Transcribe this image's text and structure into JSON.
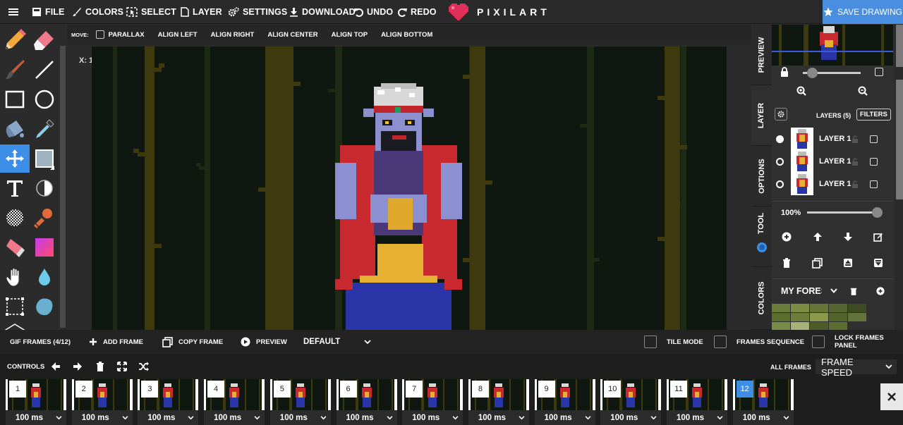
{
  "topbar": {
    "menu": [
      {
        "label": "FILE",
        "icon": "file-icon"
      },
      {
        "label": "COLORS",
        "icon": "brush-icon"
      },
      {
        "label": "SELECT",
        "icon": "select-icon"
      },
      {
        "label": "LAYER",
        "icon": "page-icon"
      },
      {
        "label": "SETTINGS",
        "icon": "gears-icon"
      },
      {
        "label": "DOWNLOAD",
        "icon": "download-icon"
      },
      {
        "label": "UNDO",
        "icon": "undo-icon"
      },
      {
        "label": "REDO",
        "icon": "redo-icon"
      }
    ],
    "brand": "PIXILART",
    "save_label": "SAVE DRAWING"
  },
  "tools": [
    "pencil-icon",
    "eraser-icon",
    "brush-icon",
    "line-icon",
    "rectangle-icon",
    "circle-icon",
    "bucket-icon",
    "eyedropper-icon",
    "move-icon",
    "fill-shape-icon",
    "text-icon",
    "lighten-icon",
    "dither-icon",
    "stamp-icon",
    "eraser-color-icon",
    "gradient-icon",
    "hand-icon",
    "drop-icon",
    "select-rect-icon",
    "blob-icon"
  ],
  "options": {
    "move_label": "MOVE:",
    "parallax": "PARALLAX",
    "align": [
      "ALIGN LEFT",
      "ALIGN RIGHT",
      "ALIGN CENTER",
      "ALIGN TOP",
      "ALIGN BOTTOM"
    ]
  },
  "canvas": {
    "coords": "X: 1"
  },
  "sidetabs": [
    "PREVIEW",
    "LAYER",
    "OPTIONS",
    "TOOL",
    "COLORS"
  ],
  "layers": {
    "title": "LAYERS (5)",
    "filters": "FILTERS",
    "items": [
      {
        "name": "LAYER 1 (",
        "selected": true
      },
      {
        "name": "LAYER 1 (",
        "selected": false
      },
      {
        "name": "LAYER 1",
        "selected": false
      }
    ],
    "opacity": "100%",
    "palette_name": "MY FORES"
  },
  "palette_colors": [
    "#6b7a3a",
    "#7d8b44",
    "#687536",
    "#566530",
    "#3e4b21",
    "#5c6b2e",
    "#6d7c3a",
    "#8a9a4a",
    "#53622b",
    "#63743a",
    "#7a8a48",
    "#a8b07a",
    "#4d5c29",
    "#5d6d31"
  ],
  "frames_bar": {
    "gif_frames": "GIF FRAMES (4/12)",
    "add_frame": "ADD FRAME",
    "copy_frame": "COPY FRAME",
    "preview": "PREVIEW",
    "mode": "DEFAULT",
    "tile_mode": "TILE MODE",
    "frames_sequence": "FRAMES SEQUENCE",
    "lock_panel": "LOCK FRAMES PANEL"
  },
  "controls": {
    "label": "CONTROLS",
    "all_frames": "ALL FRAMES",
    "frame_speed": "FRAME SPEED"
  },
  "frames": [
    {
      "num": "1",
      "speed": "100 ms"
    },
    {
      "num": "2",
      "speed": "100 ms"
    },
    {
      "num": "3",
      "speed": "100 ms"
    },
    {
      "num": "4",
      "speed": "100 ms"
    },
    {
      "num": "5",
      "speed": "100 ms"
    },
    {
      "num": "6",
      "speed": "100 ms"
    },
    {
      "num": "7",
      "speed": "100 ms"
    },
    {
      "num": "8",
      "speed": "100 ms"
    },
    {
      "num": "9",
      "speed": "100 ms"
    },
    {
      "num": "10",
      "speed": "100 ms"
    },
    {
      "num": "11",
      "speed": "100 ms"
    },
    {
      "num": "12",
      "speed": "100 ms"
    }
  ],
  "active_frame": "12",
  "colors": {
    "accent": "#3d8ee6",
    "save": "#4a8ee0",
    "brand_heart": "#e0305a"
  }
}
